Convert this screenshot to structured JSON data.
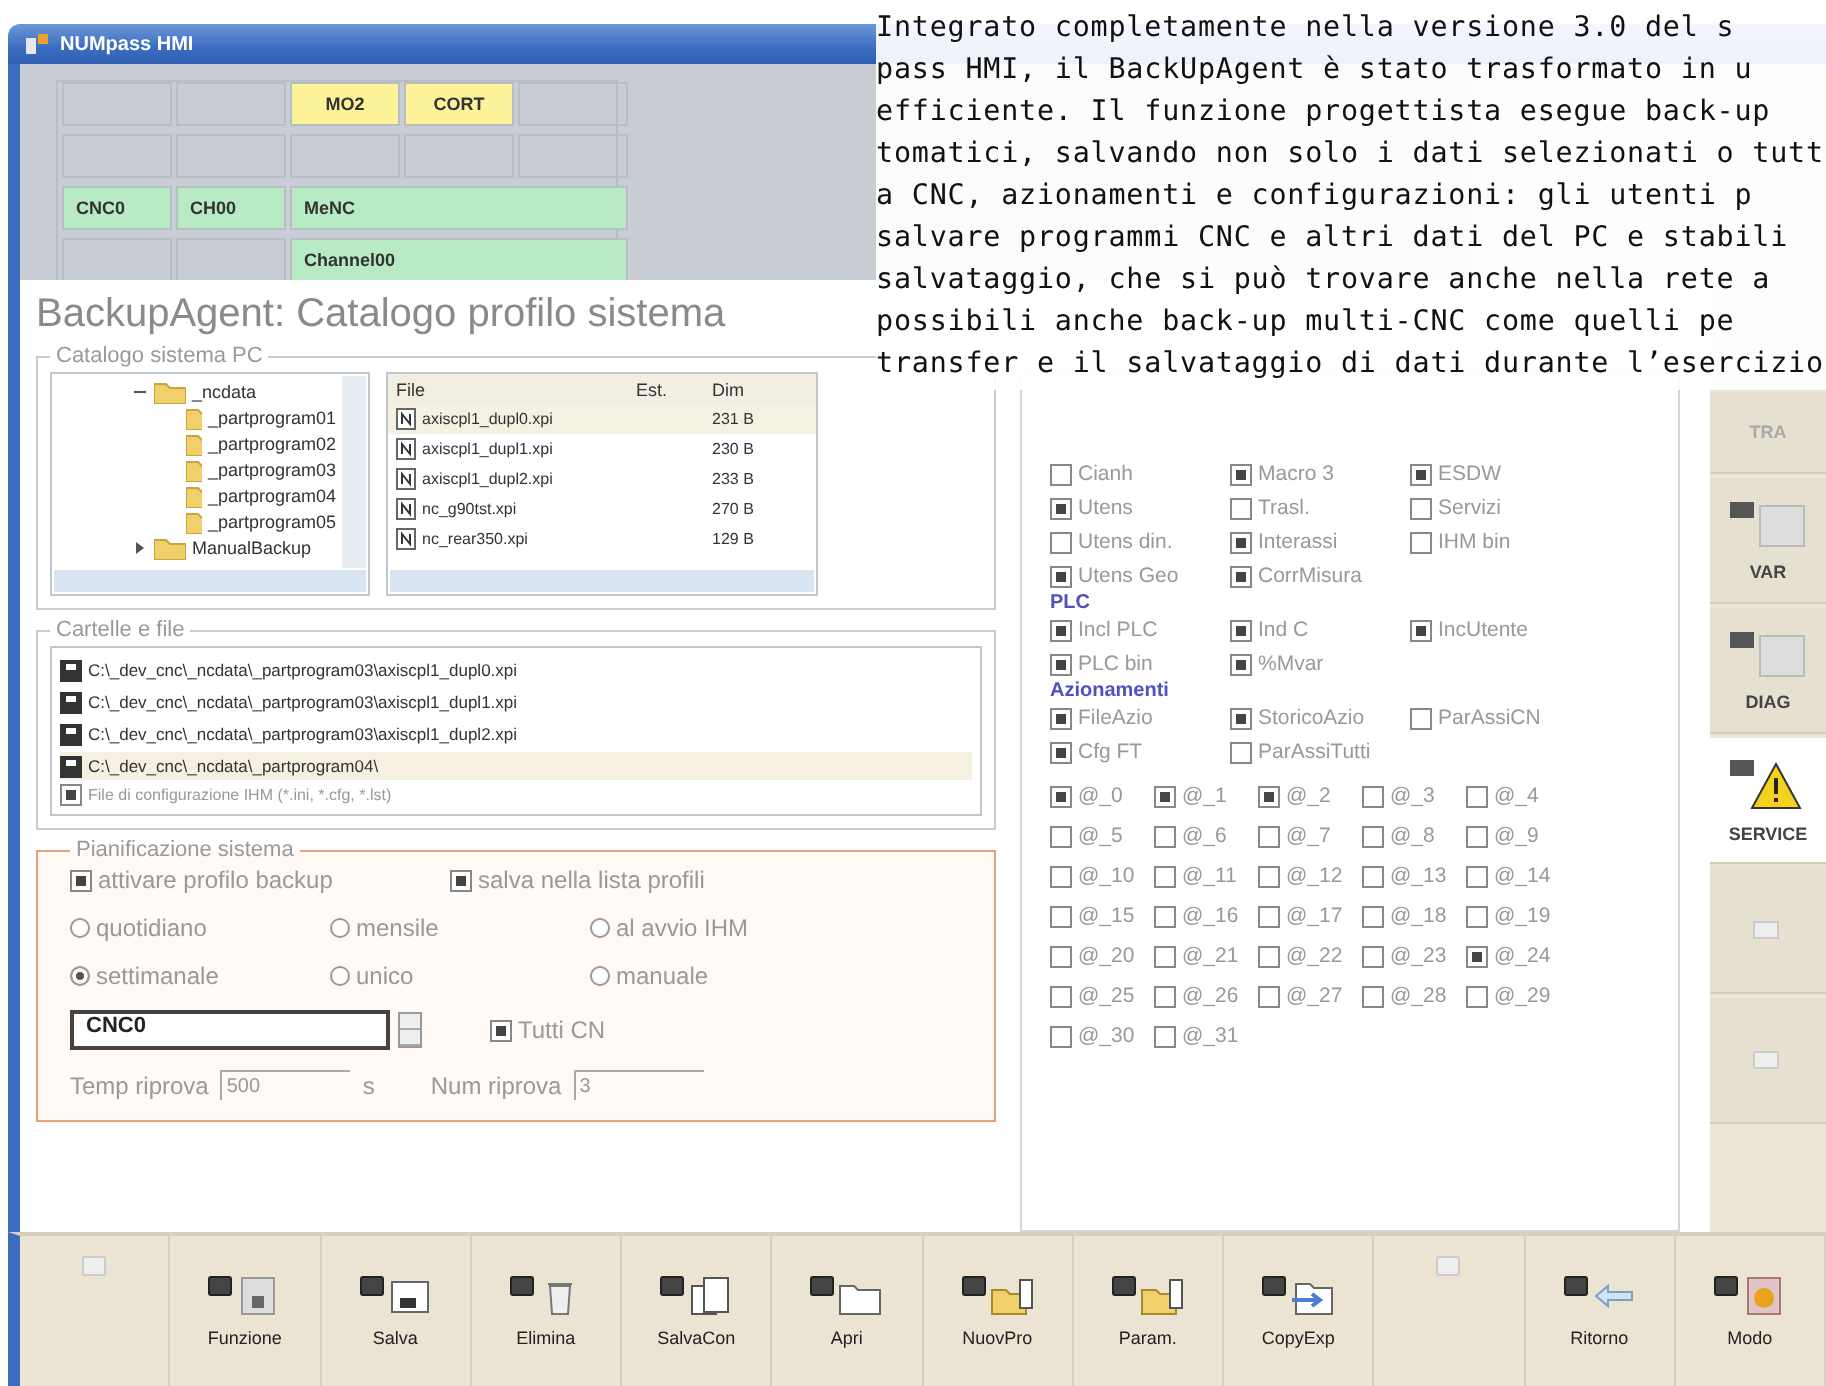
{
  "window": {
    "title": "NUMpass HMI"
  },
  "header": {
    "rows": [
      [
        {
          "kind": "blank"
        },
        {
          "kind": "blank"
        },
        {
          "kind": "warn",
          "text": "MO2"
        },
        {
          "kind": "warn",
          "text": "CORT"
        },
        {
          "kind": "blank"
        }
      ],
      [
        {
          "kind": "blank"
        },
        {
          "kind": "blank"
        },
        {
          "kind": "blank"
        },
        {
          "kind": "blank"
        },
        {
          "kind": "blank"
        }
      ],
      [
        {
          "kind": "ok",
          "text": "CNC0"
        },
        {
          "kind": "ok",
          "text": "CH00"
        },
        {
          "kind": "ok",
          "text": "MeNC"
        }
      ],
      [
        {
          "kind": "blank"
        },
        {
          "kind": "blank"
        },
        {
          "kind": "ok",
          "text": "Channel00"
        }
      ]
    ]
  },
  "page_title": "BackupAgent: Catalogo profilo sistema",
  "catalog": {
    "legend": "Catalogo sistema PC",
    "tree": [
      {
        "label": "_ncdata",
        "expanded": true,
        "children": [
          {
            "label": "_partprogram01"
          },
          {
            "label": "_partprogram02"
          },
          {
            "label": "_partprogram03"
          },
          {
            "label": "_partprogram04"
          },
          {
            "label": "_partprogram05"
          }
        ]
      },
      {
        "label": "ManualBackup",
        "expanded": false
      }
    ],
    "file_columns": [
      "File",
      "Est.",
      "Dim"
    ],
    "files": [
      {
        "name": "axiscpl1_dupl0.xpi",
        "size": "231 B",
        "selected": true
      },
      {
        "name": "axiscpl1_dupl1.xpi",
        "size": "230 B",
        "selected": false
      },
      {
        "name": "axiscpl1_dupl2.xpi",
        "size": "233 B",
        "selected": false
      },
      {
        "name": "nc_g90tst.xpi",
        "size": "270 B",
        "selected": false
      },
      {
        "name": "nc_rear350.xpi",
        "size": "129 B",
        "selected": false
      }
    ]
  },
  "folders_files": {
    "legend": "Cartelle e file",
    "paths": [
      {
        "text": "C:\\_dev_cnc\\_ncdata\\_partprogram03\\axiscpl1_dupl0.xpi",
        "selected": false
      },
      {
        "text": "C:\\_dev_cnc\\_ncdata\\_partprogram03\\axiscpl1_dupl1.xpi",
        "selected": false
      },
      {
        "text": "C:\\_dev_cnc\\_ncdata\\_partprogram03\\axiscpl1_dupl2.xpi",
        "selected": false
      },
      {
        "text": "C:\\_dev_cnc\\_ncdata\\_partprogram04\\",
        "selected": true
      }
    ],
    "config": {
      "label": "File di configurazione IHM (*.ini, *.cfg, *.lst)",
      "checked": true
    }
  },
  "planning": {
    "legend": "Pianificazione sistema",
    "checkboxes": [
      {
        "label": "attivare profilo backup",
        "checked": true
      },
      {
        "label": "salva nella lista profili",
        "checked": true
      }
    ],
    "radios": [
      {
        "label": "quotidiano",
        "selected": false
      },
      {
        "label": "mensile",
        "selected": false
      },
      {
        "label": "al avvio IHM",
        "selected": false
      },
      {
        "label": "settimanale",
        "selected": true
      },
      {
        "label": "unico",
        "selected": false
      },
      {
        "label": "manuale",
        "selected": false
      }
    ],
    "cn_select": {
      "value": "CNC0"
    },
    "all_cn": {
      "label": "Tutti CN",
      "checked": true
    },
    "retry_time": {
      "label": "Temp riprova",
      "value": "500",
      "unit": "s"
    },
    "retry_count": {
      "label": "Num riprova",
      "value": "3"
    }
  },
  "options": {
    "groups": [
      {
        "items": [
          {
            "label": "Cianh",
            "checked": false
          },
          {
            "label": "Macro 3",
            "checked": true
          },
          {
            "label": "ESDW",
            "checked": true
          },
          {
            "label": "Utens",
            "checked": true
          },
          {
            "label": "Trasl.",
            "checked": false
          },
          {
            "label": "Servizi",
            "checked": false
          },
          {
            "label": "Utens din.",
            "checked": false
          },
          {
            "label": "Interassi",
            "checked": true
          },
          {
            "label": "IHM bin",
            "checked": false
          },
          {
            "label": "Utens Geo",
            "checked": true
          },
          {
            "label": "CorrMisura",
            "checked": true
          }
        ]
      },
      {
        "heading": "PLC",
        "items": [
          {
            "label": "Incl PLC",
            "checked": true
          },
          {
            "label": "Ind C",
            "checked": true
          },
          {
            "label": "IncUtente",
            "checked": true
          },
          {
            "label": "PLC bin",
            "checked": true
          },
          {
            "label": "%Mvar",
            "checked": true
          }
        ]
      },
      {
        "heading": "Azionamenti",
        "items": [
          {
            "label": "FileAzio",
            "checked": true
          },
          {
            "label": "StoricoAzio",
            "checked": true
          },
          {
            "label": "ParAssiCN",
            "checked": false
          },
          {
            "label": "Cfg FT",
            "checked": true
          },
          {
            "label": "ParAssiTutti",
            "checked": false
          }
        ]
      }
    ],
    "bits": [
      {
        "label": "@_0",
        "checked": true
      },
      {
        "label": "@_1",
        "checked": true
      },
      {
        "label": "@_2",
        "checked": true
      },
      {
        "label": "@_3",
        "checked": false
      },
      {
        "label": "@_4",
        "checked": false
      },
      {
        "label": "@_5",
        "checked": false
      },
      {
        "label": "@_6",
        "checked": false
      },
      {
        "label": "@_7",
        "checked": false
      },
      {
        "label": "@_8",
        "checked": false
      },
      {
        "label": "@_9",
        "checked": false
      },
      {
        "label": "@_10",
        "checked": false
      },
      {
        "label": "@_11",
        "checked": false
      },
      {
        "label": "@_12",
        "checked": false
      },
      {
        "label": "@_13",
        "checked": false
      },
      {
        "label": "@_14",
        "checked": false
      },
      {
        "label": "@_15",
        "checked": false
      },
      {
        "label": "@_16",
        "checked": false
      },
      {
        "label": "@_17",
        "checked": false
      },
      {
        "label": "@_18",
        "checked": false
      },
      {
        "label": "@_19",
        "checked": false
      },
      {
        "label": "@_20",
        "checked": false
      },
      {
        "label": "@_21",
        "checked": false
      },
      {
        "label": "@_22",
        "checked": false
      },
      {
        "label": "@_23",
        "checked": false
      },
      {
        "label": "@_24",
        "checked": true
      },
      {
        "label": "@_25",
        "checked": false
      },
      {
        "label": "@_26",
        "checked": false
      },
      {
        "label": "@_27",
        "checked": false
      },
      {
        "label": "@_28",
        "checked": false
      },
      {
        "label": "@_29",
        "checked": false
      },
      {
        "label": "@_30",
        "checked": false
      },
      {
        "label": "@_31",
        "checked": false
      }
    ]
  },
  "sidebar": {
    "items": [
      {
        "label": "TRA",
        "selected": false,
        "kind": "plain"
      },
      {
        "label": "VAR",
        "selected": false,
        "kind": "table"
      },
      {
        "label": "DIAG",
        "selected": false,
        "kind": "table"
      },
      {
        "label": "SERVICE",
        "selected": true,
        "kind": "warning"
      },
      {
        "selected": false,
        "kind": "key"
      },
      {
        "selected": false,
        "kind": "key"
      }
    ]
  },
  "softkeys": [
    {
      "disabled": true,
      "kind": "empty"
    },
    {
      "label": "Funzione",
      "disabled": false,
      "kind": "function"
    },
    {
      "label": "Salva",
      "disabled": false,
      "kind": "save"
    },
    {
      "label": "Elimina",
      "disabled": false,
      "kind": "delete"
    },
    {
      "label": "SalvaCon",
      "disabled": false,
      "kind": "saveas"
    },
    {
      "label": "Apri",
      "disabled": false,
      "kind": "folder"
    },
    {
      "label": "NuovPro",
      "disabled": false,
      "kind": "newfolder"
    },
    {
      "label": "Param.",
      "disabled": false,
      "kind": "newfolder"
    },
    {
      "label": "CopyExp",
      "disabled": false,
      "kind": "copy"
    },
    {
      "disabled": true,
      "kind": "empty"
    },
    {
      "label": "Ritorno",
      "disabled": false,
      "kind": "back"
    },
    {
      "label": "Modo",
      "disabled": false,
      "kind": "mode"
    }
  ],
  "article": {
    "lines": [
      "Integrato completamente nella versione 3.0 del s",
      "pass HMI, il BackUpAgent è stato trasformato in u",
      "efficiente. Il funzione progettista esegue back-up",
      "tomatici, salvando non solo i dati selezionati o tutt",
      "a CNC, azionamenti e configurazioni: gli utenti p",
      "salvare programmi CNC e altri dati del PC e stabili",
      "salvataggio, che si può trovare anche nella rete a",
      "possibili anche back-up multi-CNC come quelli pe",
      "transfer e il salvataggio di dati durante l’esercizio"
    ]
  }
}
